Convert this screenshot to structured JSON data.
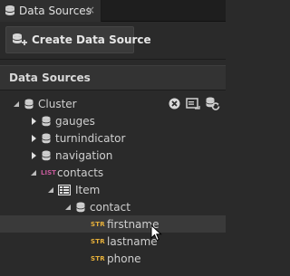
{
  "tab": {
    "title": "Data Sources",
    "close_glyph": "×"
  },
  "toolbar": {
    "create_label": "Create Data Source"
  },
  "panel": {
    "title": "Data Sources"
  },
  "tree": {
    "root": "Cluster",
    "children": [
      {
        "label": "gauges"
      },
      {
        "label": "turnindicator"
      },
      {
        "label": "navigation"
      }
    ],
    "list": {
      "badge": "LIST",
      "label": "contacts"
    },
    "item": "Item",
    "contact": "contact",
    "str_badge": "STR",
    "fields": [
      "firstname",
      "lastname",
      "phone"
    ]
  }
}
